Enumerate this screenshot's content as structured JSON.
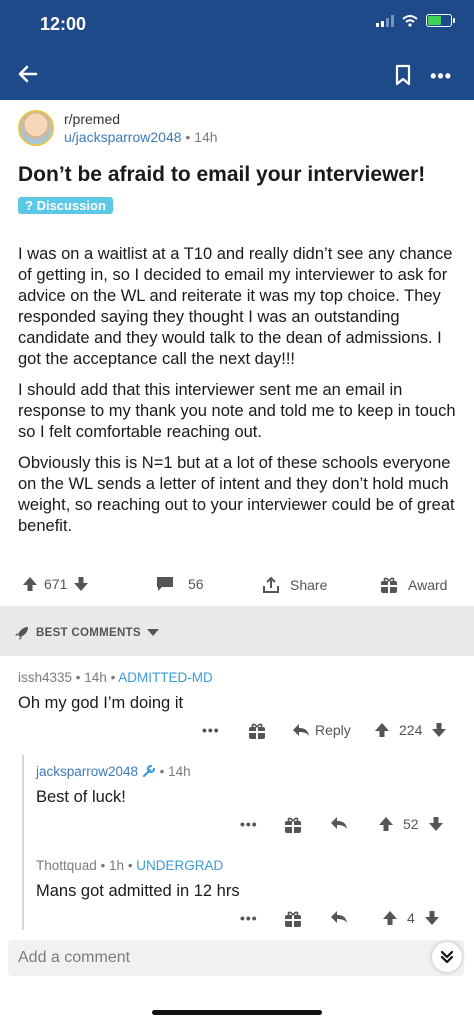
{
  "status": {
    "time": "12:00"
  },
  "post": {
    "subreddit": "r/premed",
    "author": "u/jacksparrow2048",
    "age": "14h",
    "title": "Don’t be afraid to email your interviewer!",
    "flair": "Discussion",
    "paragraphs": [
      "I was on a waitlist at a T10 and really didn’t see any chance of getting in, so I decided to email my interviewer to ask for advice on the WL and reiterate it was my top choice. They responded saying they thought I was an outstanding candidate and they would talk to the dean of admissions. I got the acceptance call the next day!!!",
      "I should add that this interviewer sent me an email in response to my thank you note and told me to keep in touch so I felt comfortable reaching out.",
      "Obviously this is N=1 but at a lot of these schools everyone on the WL sends a letter of intent and they don’t hold much weight, so reaching out to your interviewer could be of great benefit."
    ],
    "votes": "671",
    "comments": "56",
    "share_label": "Share",
    "award_label": "Award"
  },
  "sort_label": "BEST COMMENTS",
  "comments": [
    {
      "user": "issh4335",
      "age": "14h",
      "flair": "ADMITTED-MD",
      "text": "Oh my god I’m doing it",
      "reply_label": "Reply",
      "votes": "224"
    },
    {
      "user": "jacksparrow2048",
      "age": "14h",
      "text": "Best of luck!",
      "votes": "52"
    },
    {
      "user": "Thottquad",
      "age": "1h",
      "flair": "UNDERGRAD",
      "text": "Mans got admitted in 12 hrs",
      "votes": "4"
    }
  ],
  "composer": {
    "placeholder": "Add a comment"
  },
  "colors": {
    "header": "#1f4a8a",
    "accent": "#3d7ab8",
    "flair": "#5bc8e6"
  },
  "icons": [
    "back-arrow-icon",
    "bookmark-icon",
    "more-icon",
    "upvote-icon",
    "downvote-icon",
    "comment-icon",
    "share-icon",
    "award-icon",
    "rocket-icon",
    "reply-icon",
    "chevron-down-icon",
    "mod-wrench-icon"
  ]
}
